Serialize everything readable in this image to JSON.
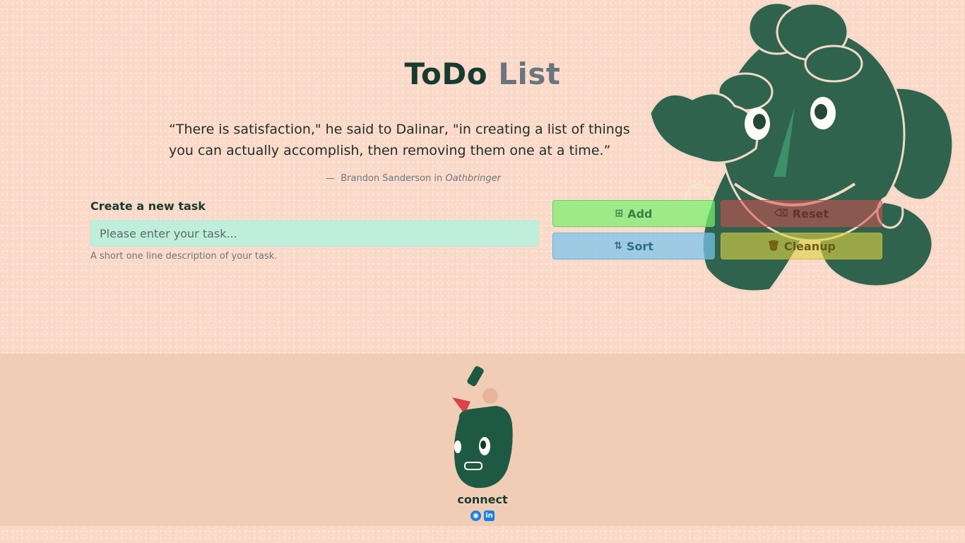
{
  "header": {
    "title_main": "ToDo",
    "title_accent": "List"
  },
  "quote": {
    "text": "“There is satisfaction,\" he said to Dalinar, \"in creating a list of things you can actually accomplish, then removing them one at a time.”",
    "dash": "—",
    "author": "Brandon Sanderson in",
    "book": "Oathbringer"
  },
  "task_form": {
    "label": "Create a new task",
    "placeholder": "Please enter your task...",
    "value": "",
    "help": "A short one line description of your task."
  },
  "buttons": {
    "add": "Add",
    "reset": "Reset",
    "sort": "Sort",
    "cleanup": "Cleanup"
  },
  "icons": {
    "add": "plus-square-icon",
    "reset": "backspace-icon",
    "sort": "sort-icon",
    "cleanup": "trash-icon",
    "github": "github-icon",
    "linkedin": "linkedin-icon"
  },
  "footer": {
    "connect": "connect"
  },
  "colors": {
    "background": "#fbd9c8",
    "footer_bg": "#f1cdb6",
    "title": "#173b2f",
    "accent_muted": "#6c757d",
    "mascot": "#1e5a43"
  }
}
